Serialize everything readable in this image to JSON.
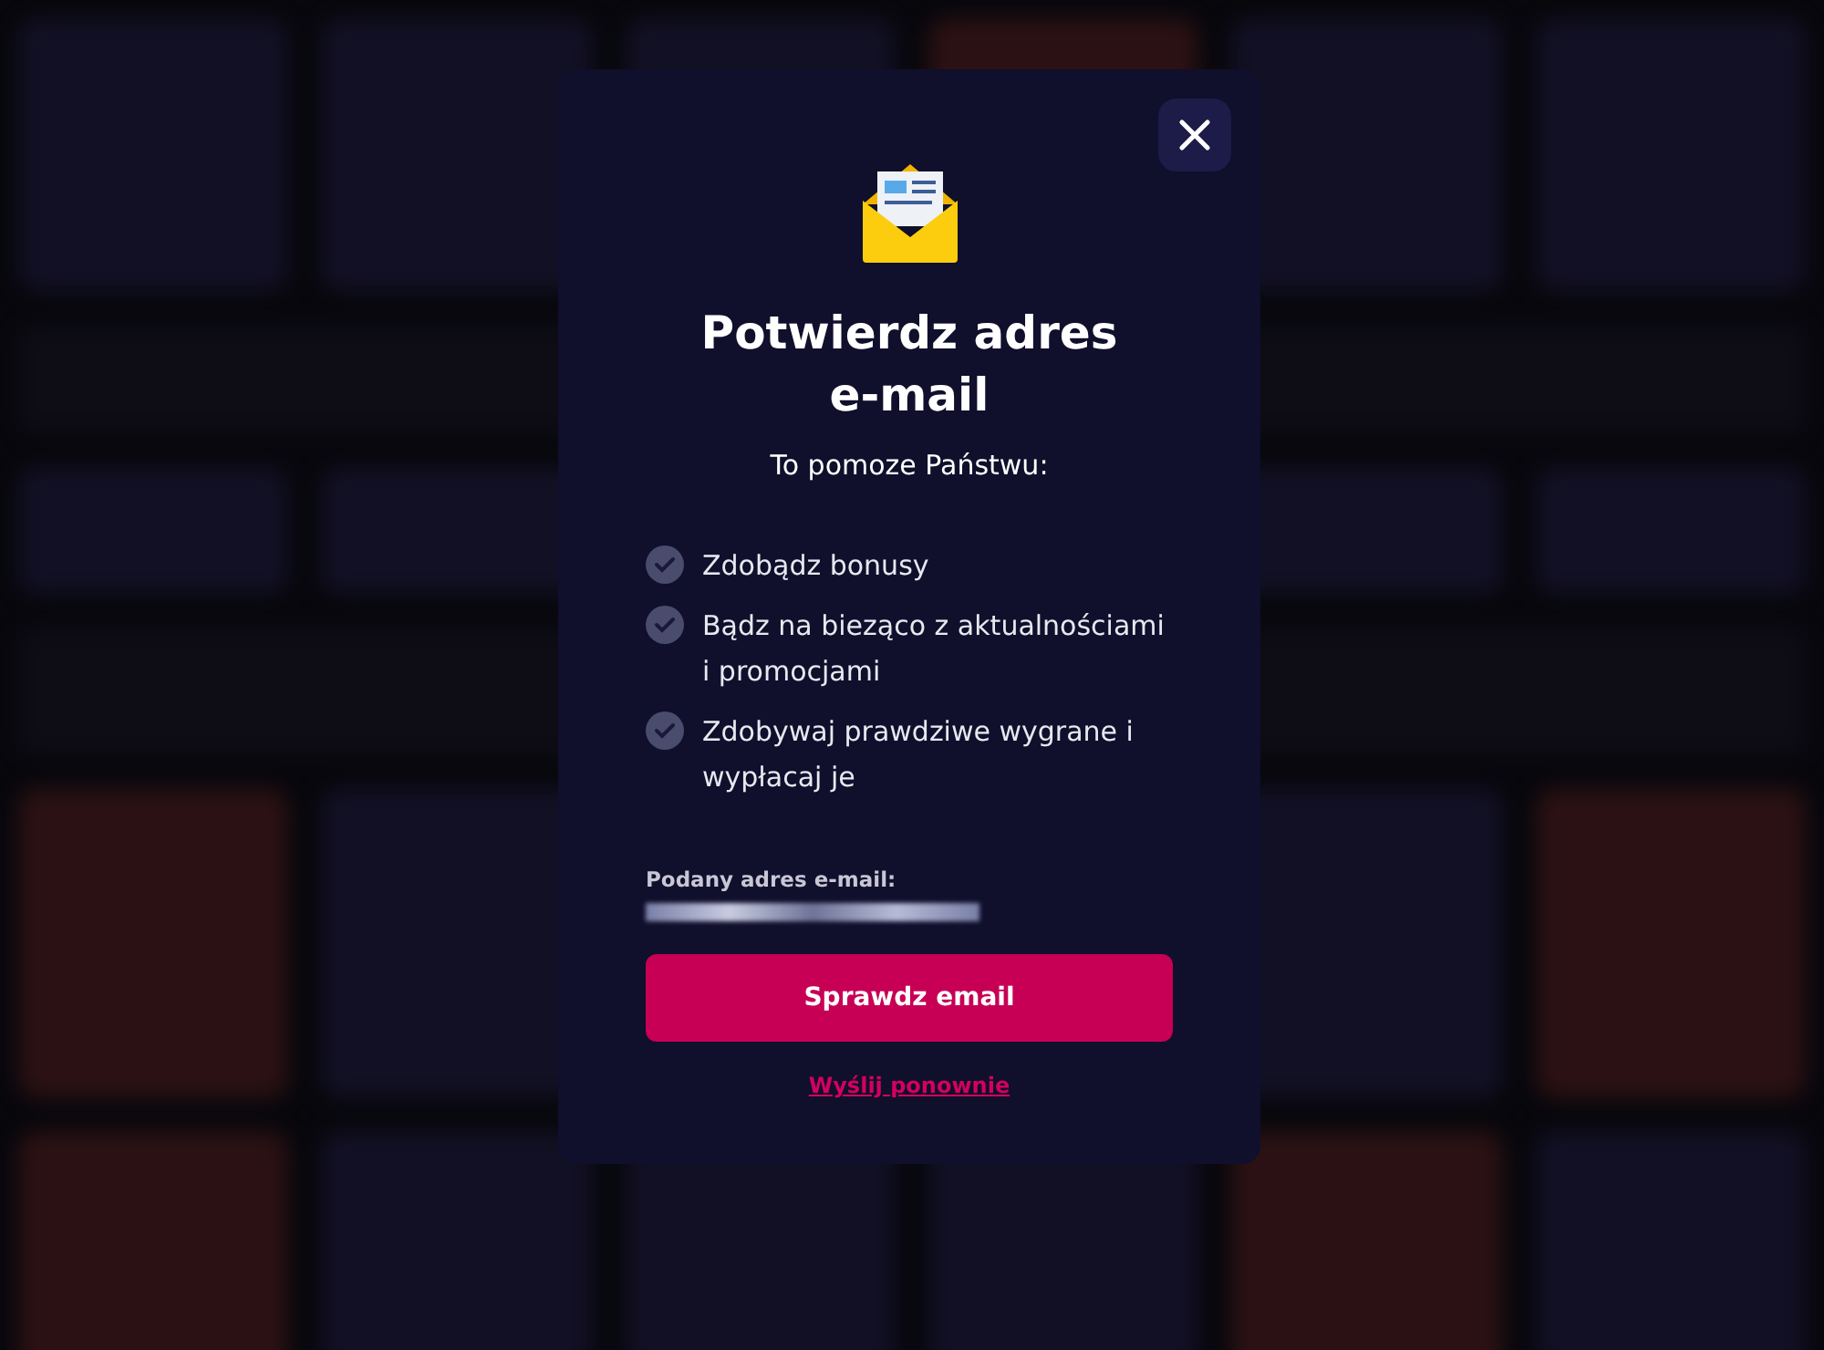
{
  "dialog": {
    "title": "Potwierdz adres e-mail",
    "subtitle": "To pomoze Państwu:",
    "benefits": [
      {
        "text": "Zdobądz bonusy"
      },
      {
        "text": "Bądz na bieząco z aktualnościami i promocjami"
      },
      {
        "text": "Zdobywaj prawdziwe wygrane i wypłacaj je"
      }
    ],
    "email_label": "Podany adres e-mail:",
    "primary_button": "Sprawdz email",
    "resend_link": "Wyślij ponownie"
  }
}
